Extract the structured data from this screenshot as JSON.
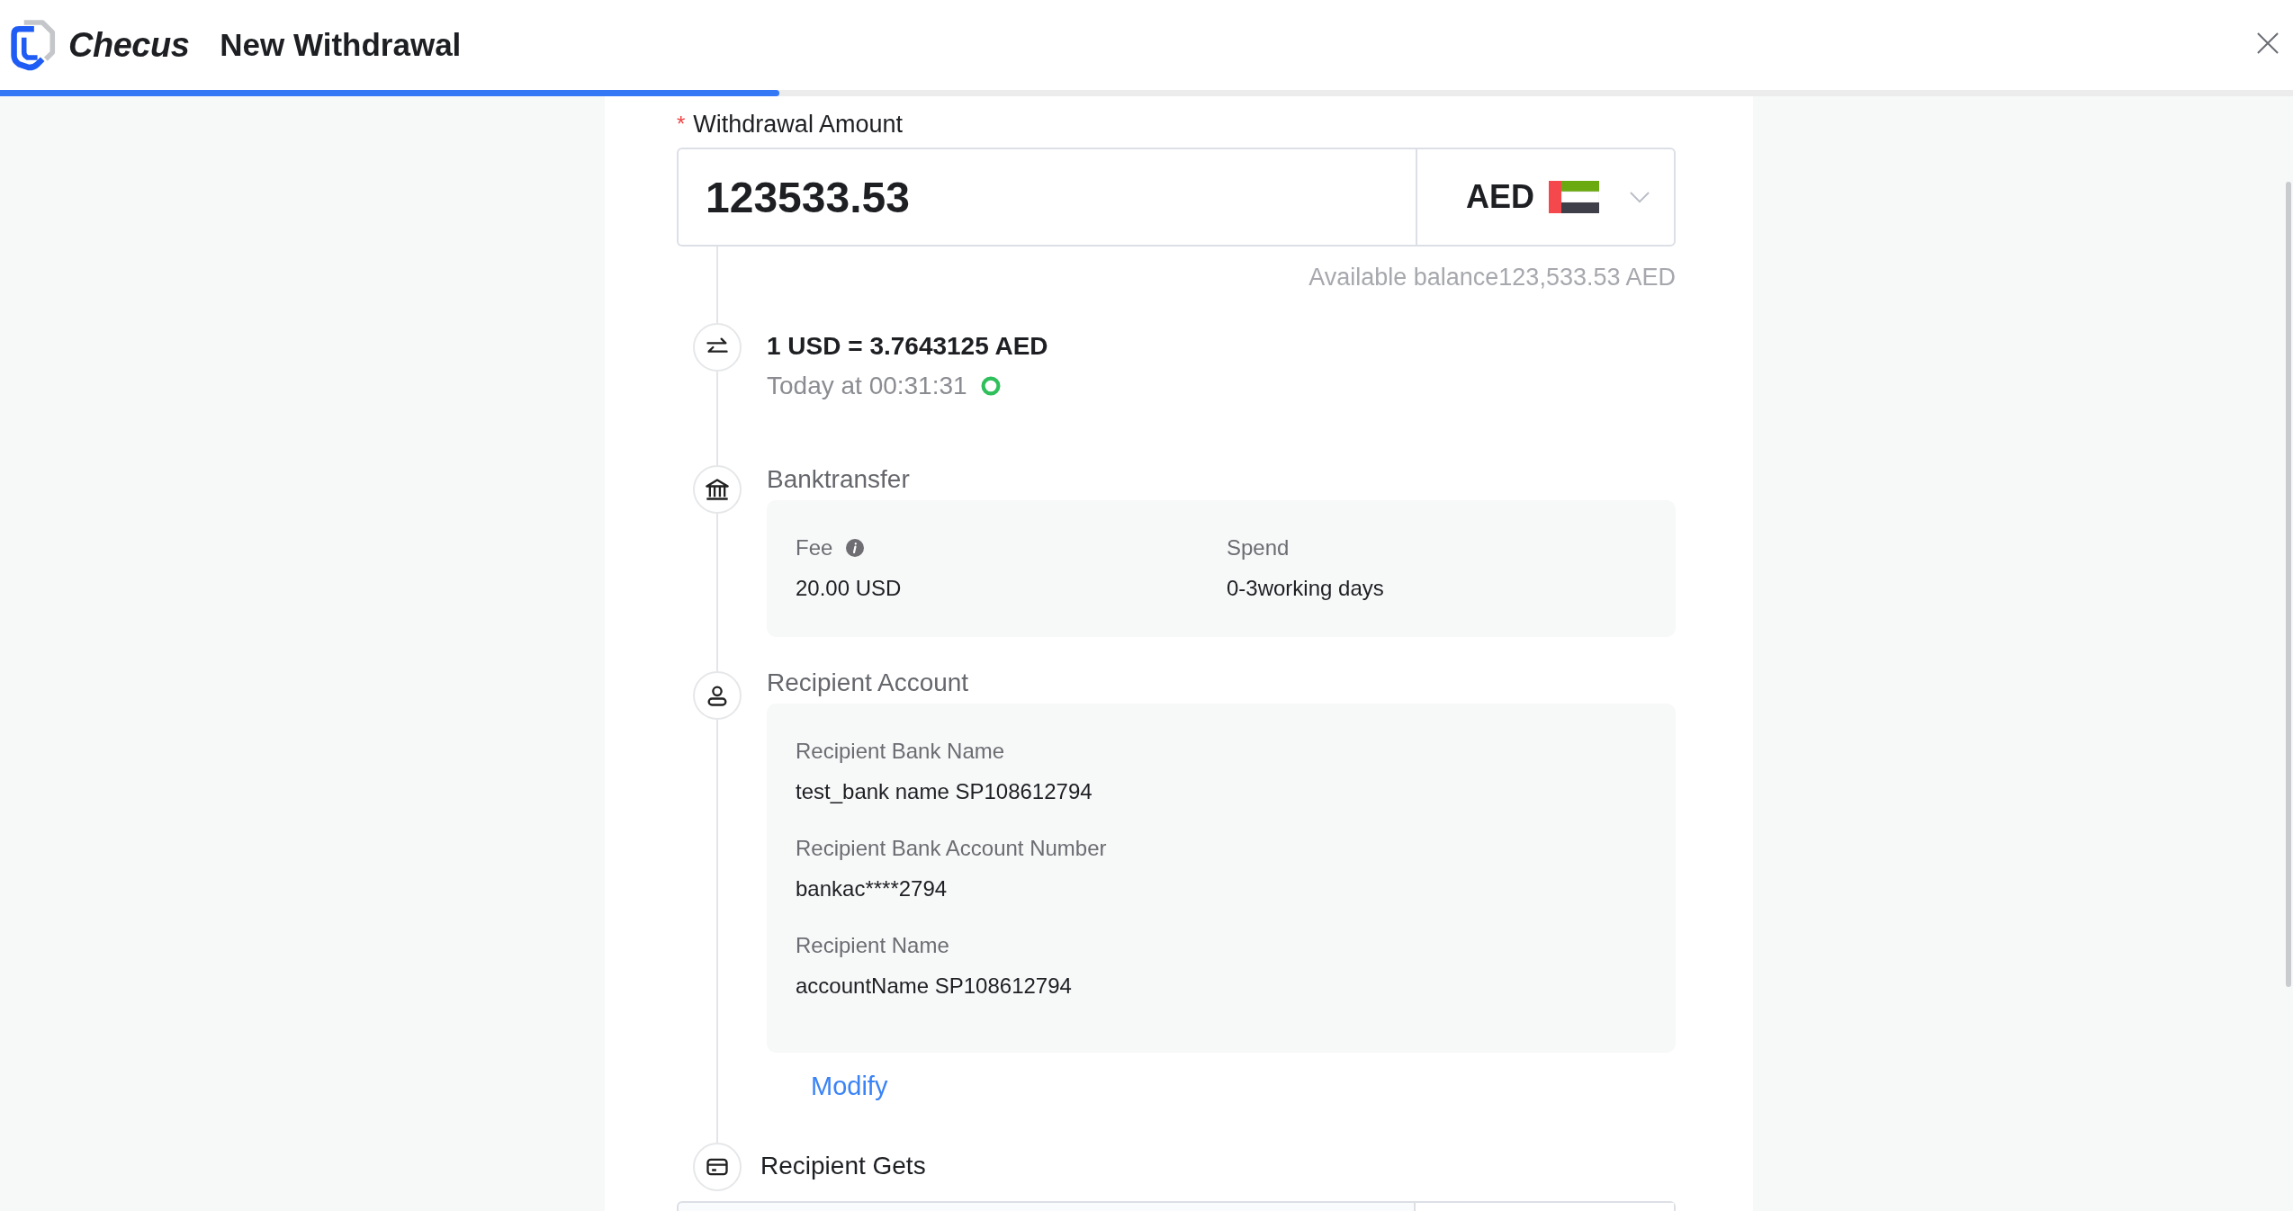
{
  "header": {
    "brand": "Checus",
    "title": "New Withdrawal"
  },
  "progress": {
    "level": 0.34
  },
  "amount": {
    "required_mark": "*",
    "label": "Withdrawal Amount",
    "value": "123533.53",
    "currency": "AED",
    "balance": "Available balance123,533.53 AED"
  },
  "steps": [
    {
      "kind": "rate",
      "rate": "1 USD = 3.7643125 AED",
      "time": "Today at 00:31:31"
    },
    {
      "kind": "method",
      "title": "Banktransfer",
      "fields": [
        {
          "label": "Fee",
          "info": true,
          "value": "20.00 USD"
        },
        {
          "label": "Spend",
          "info": false,
          "value": "0-3working days"
        }
      ]
    },
    {
      "kind": "account",
      "title": "Recipient Account",
      "fields": [
        {
          "label": "Recipient Bank Name",
          "info": false,
          "value": "test_bank name SP108612794"
        },
        {
          "label": "Recipient Bank Account Number",
          "info": false,
          "value": "bankac****2794"
        },
        {
          "label": "Recipient Name",
          "info": false,
          "value": "accountName SP108612794"
        }
      ],
      "action": "Modify"
    },
    {
      "kind": "gets",
      "title": "Recipient Gets"
    }
  ]
}
